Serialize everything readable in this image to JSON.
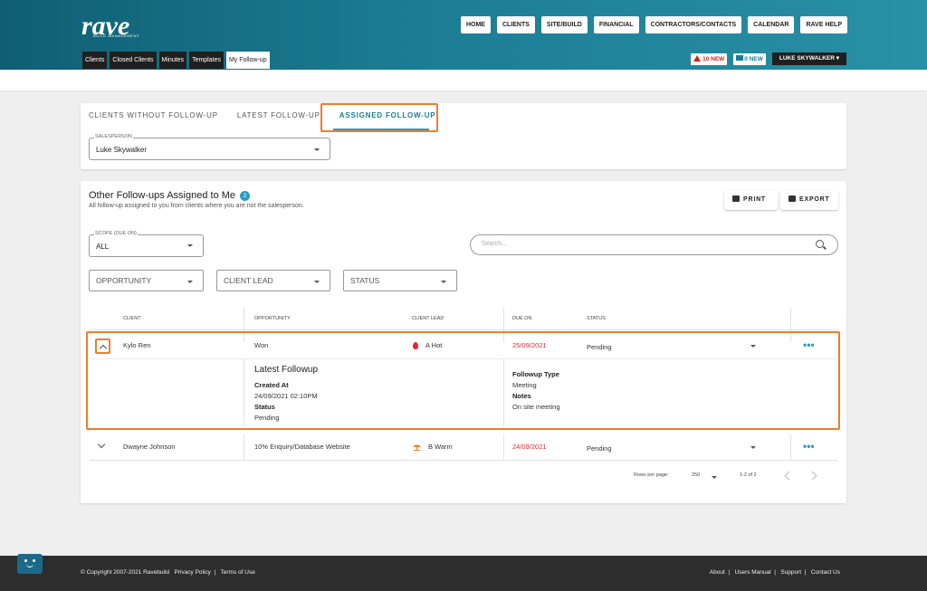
{
  "brand": {
    "logo_text": "rave",
    "sub": "BUILD MANAGEMENT",
    "accent": "#1b7d93",
    "highlight": "#ef7d2c"
  },
  "topnav": [
    "HOME",
    "CLIENTS",
    "SITE/BUILD",
    "FINANCIAL",
    "CONTRACTORS/CONTACTS",
    "CALENDAR",
    "RAVE HELP"
  ],
  "subtabs": [
    "Clients",
    "Closed Clients",
    "Minutes",
    "Templates",
    "My Follow-up"
  ],
  "alerts": {
    "red": "10 NEW",
    "blue": "0 NEW"
  },
  "user": "LUKE SKYWALKER",
  "main_tabs": [
    "CLIENTS WITHOUT FOLLOW-UP",
    "LATEST FOLLOW-UP",
    "ASSIGNED FOLLOW-UP"
  ],
  "salesperson": {
    "label": "SALESPERSON",
    "value": "Luke Skywalker"
  },
  "section": {
    "title": "Other Follow-ups Assigned to Me",
    "count": "2",
    "subtitle": "All follow-up assigned to you from clients where you are not the salesperson.",
    "print": "PRINT",
    "export": "EXPORT"
  },
  "scope": {
    "label": "SCOPE (DUE ON)",
    "value": "ALL"
  },
  "search": {
    "placeholder": "Search..."
  },
  "filters": [
    "OPPORTUNITY",
    "CLIENT LEAD",
    "STATUS"
  ],
  "table": {
    "headers": [
      "CLIENT",
      "OPPORTUNITY",
      "CLIENT LEAD",
      "DUE ON",
      "STATUS"
    ],
    "rows": [
      {
        "client": "Kylo Ren",
        "opportunity": "Won",
        "lead": "A Hot",
        "due": "25/09/2021",
        "status": "Pending"
      },
      {
        "client": "Dwayne Johnson",
        "opportunity": "10% Enquiry/Database Website",
        "lead": "B Warm",
        "due": "24/09/2021",
        "status": "Pending"
      }
    ],
    "detail": {
      "heading": "Latest Followup",
      "created_label": "Created At",
      "created_value": "24/09/2021 02:10PM",
      "status_label": "Status",
      "status_value": "Pending",
      "type_label": "Followup Type",
      "type_value": "Meeting",
      "notes_label": "Notes",
      "notes_value": "On site meeting"
    }
  },
  "pagination": {
    "rows_label": "Rows per page:",
    "rows_value": "250",
    "range": "1-2 of 2"
  },
  "footer": {
    "copyright": "© Copyright 2007-2021 Ravebuild",
    "privacy": "Privacy Policy",
    "terms": "Terms of Use",
    "links": [
      "About",
      "Users Manual",
      "Support",
      "Contact Us"
    ]
  }
}
